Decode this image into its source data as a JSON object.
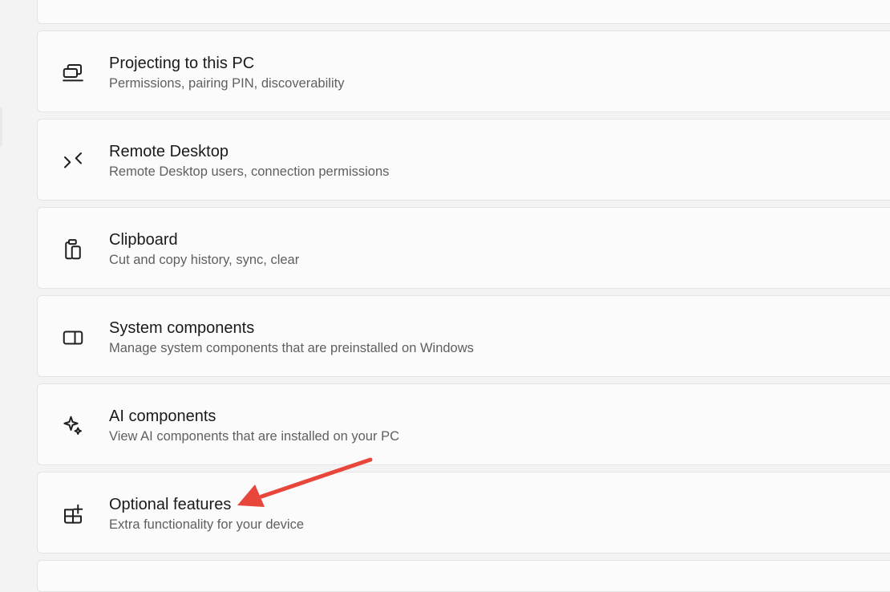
{
  "settings_list": {
    "items": [
      {
        "title": "Projecting to this PC",
        "subtitle": "Permissions, pairing PIN, discoverability",
        "icon": "projector-icon"
      },
      {
        "title": "Remote Desktop",
        "subtitle": "Remote Desktop users, connection permissions",
        "icon": "remote-desktop-icon"
      },
      {
        "title": "Clipboard",
        "subtitle": "Cut and copy history, sync, clear",
        "icon": "clipboard-icon"
      },
      {
        "title": "System components",
        "subtitle": "Manage system components that are preinstalled on Windows",
        "icon": "system-components-icon"
      },
      {
        "title": "AI components",
        "subtitle": "View AI components that are installed on your PC",
        "icon": "sparkle-icon"
      },
      {
        "title": "Optional features",
        "subtitle": "Extra functionality for your device",
        "icon": "optional-features-icon"
      }
    ]
  },
  "annotation": {
    "arrow_color": "#e8463a",
    "points_to": "Optional features"
  },
  "colors": {
    "background": "#f3f3f3",
    "card": "#fbfbfb",
    "card_border": "#e4e4e4",
    "title_text": "#1a1a1a",
    "subtitle_text": "#5f5f5f"
  }
}
